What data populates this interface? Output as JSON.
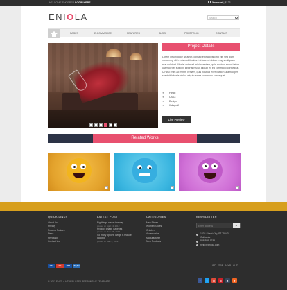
{
  "topbar": {
    "welcome": "WELCOME SHOPPER",
    "login": "LOGIN HERE",
    "cart_label": "Your cart",
    "cart_value": "| $123"
  },
  "header": {
    "logo_pre": "ENI",
    "logo_o": "O",
    "logo_post": "LA",
    "search_placeholder": "Search"
  },
  "nav": {
    "items": [
      "PAGES",
      "E-COMMERCE",
      "FEATURES",
      "BLOG",
      "PORTFOLIO",
      "CONTACT"
    ]
  },
  "project": {
    "title": "Project Details",
    "description": "Lorem ipsum dolor sit amet, consectetur adipisicing elit, sed diam nonummy nibh euismod tincidunt ut laoreet dolore magna aliquam erat volutpat. Ut wisi enim ad minim veniam, quis nostrud exerci tation ullamcorper suscipit lobortis nisl ut aliquip ex ea commodo consequat. Ut wisi enim ad minim veniam, quis nostrud exerci tation ullamcorper suscipit lobortis nisl ut aliquip ex ea commodo consequat.",
    "features": [
      "Html5",
      "CSS3",
      "Design",
      "Kalagrafi"
    ],
    "live_preview": "Live Preview",
    "slider_dots": 6,
    "active_dot": 4
  },
  "related": {
    "title": "Related Works"
  },
  "footer": {
    "quick_links": {
      "heading": "QUICK LINKS",
      "items": [
        "About Us",
        "Privacy",
        "Returns Policies",
        "News",
        "Feedback",
        "Contact Us"
      ]
    },
    "latest_post": {
      "heading": "LATEST POST",
      "posts": [
        {
          "title": "Big things are on the way",
          "date": "posted on April 24, 2012"
        },
        {
          "title": "Product Image Galleries",
          "date": "posted on June 15, 2012"
        },
        {
          "title": "So many options Beige is feature-packed",
          "date": "posted on May 9, 2012"
        }
      ]
    },
    "categories": {
      "heading": "CATEGORIES",
      "items": [
        "Men Shoes",
        "Women Shoes",
        "Children",
        "Accessories",
        "Manufacturer",
        "New Products"
      ]
    },
    "newsletter": {
      "heading": "NEWSLETTER",
      "placeholder": "Enter address",
      "button": "✔"
    },
    "contact": {
      "address_line1": "1234 Street City, ST 75043",
      "address_line2": "California",
      "phone": "888-555-1234",
      "email": "hello@Eniola.com"
    },
    "payments": [
      "VISA",
      "MC",
      "VISA",
      "PayPal"
    ],
    "currency": "USD GBP MYR AUD",
    "copyright": "© 2013 ENIOLA HTML5 / CSS3 RESPONSIVE TEMPLATE",
    "socials": [
      "f",
      "t",
      "g",
      "p",
      "t",
      "r"
    ]
  },
  "colors": {
    "accent": "#e8506f",
    "dark": "#2d2d2d",
    "gold": "#d79f1d",
    "navy": "#2c3346"
  }
}
